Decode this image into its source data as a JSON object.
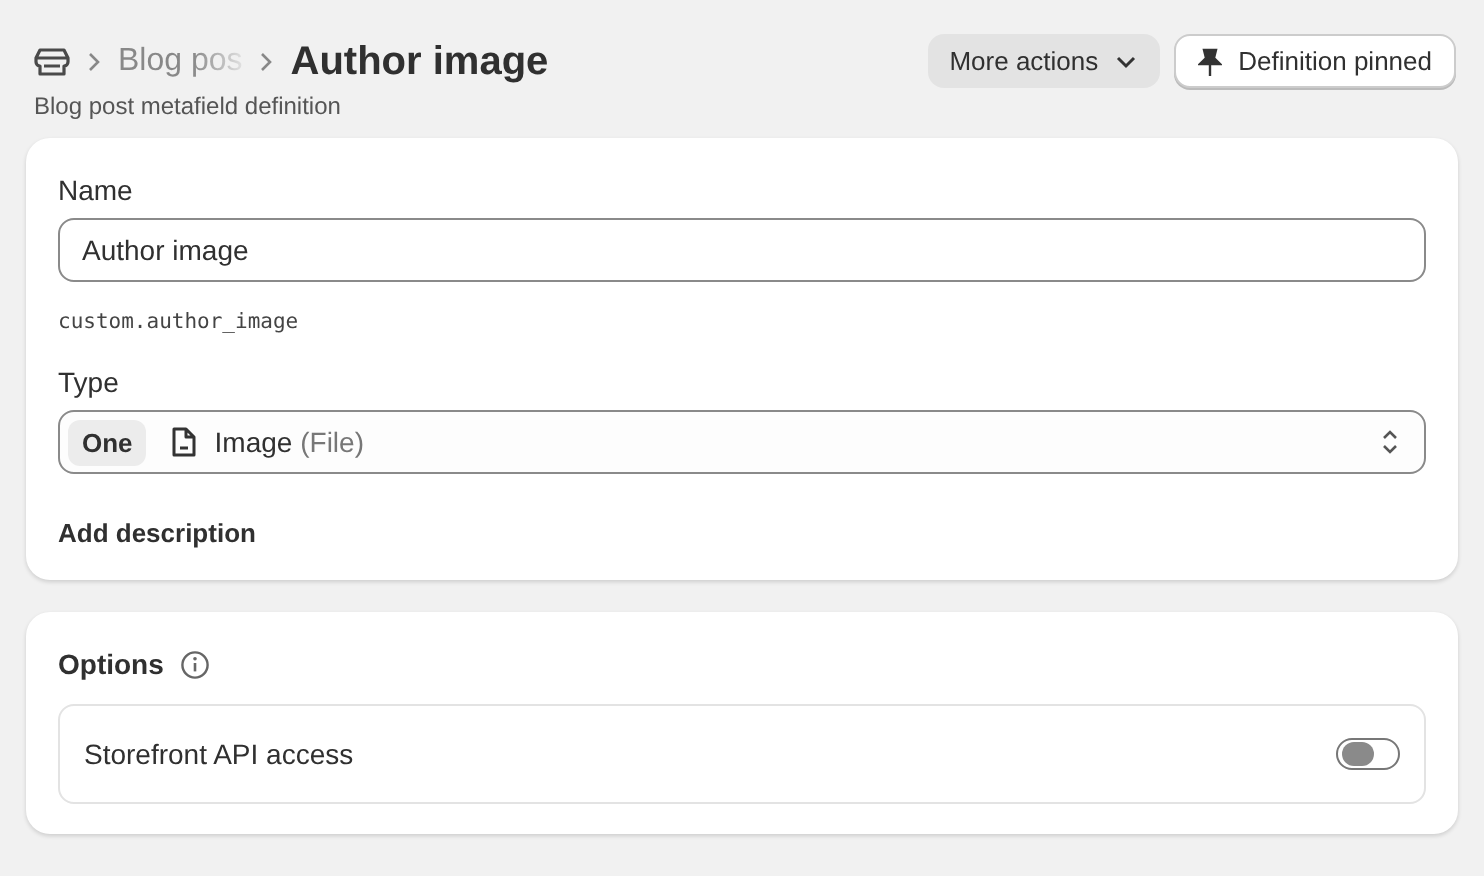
{
  "header": {
    "breadcrumbs": [
      "Blog pos"
    ],
    "title": "Author image",
    "subtitle": "Blog post metafield definition",
    "more_actions": "More actions",
    "pinned_button": "Definition pinned"
  },
  "definition": {
    "name_label": "Name",
    "name_value": "Author image",
    "key": "custom.author_image",
    "type_label": "Type",
    "type_count": "One",
    "type_value": "Image",
    "type_detail": "(File)",
    "add_description": "Add description"
  },
  "options": {
    "title": "Options",
    "items": [
      {
        "label": "Storefront API access",
        "on": false
      }
    ]
  }
}
